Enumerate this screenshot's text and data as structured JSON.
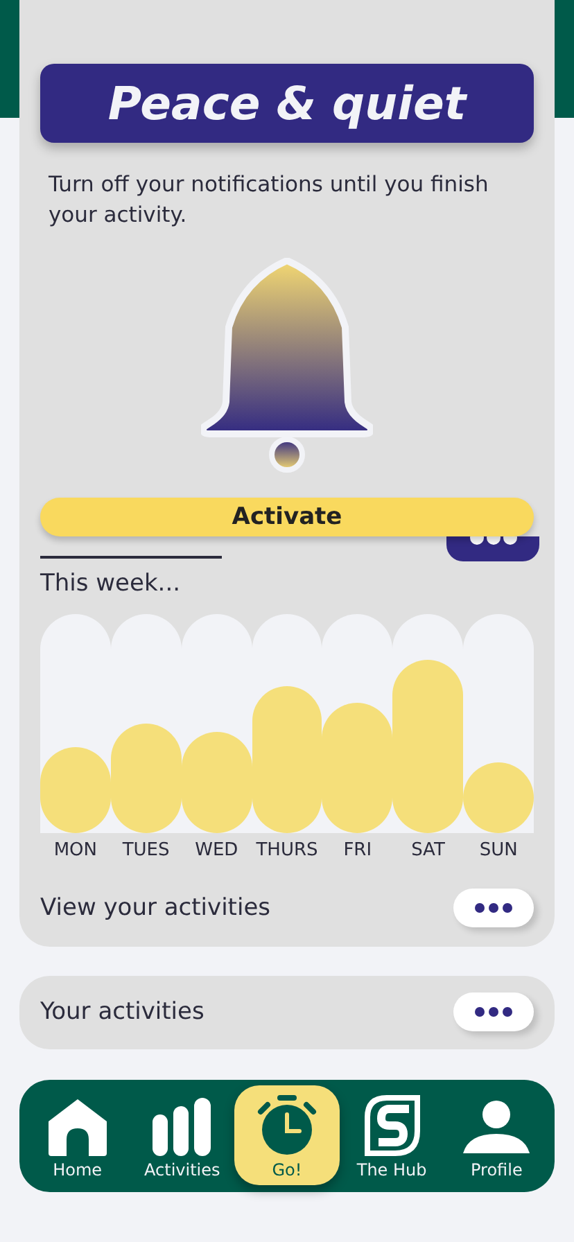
{
  "modal": {
    "title": "Peace & quiet",
    "description": "Turn off your notifications until you finish your activity.",
    "action": "Activate"
  },
  "week": {
    "title": "This week...",
    "days": [
      {
        "label": "MON",
        "level": 0.39
      },
      {
        "label": "TUES",
        "level": 0.5
      },
      {
        "label": "WED",
        "level": 0.46
      },
      {
        "label": "THURS",
        "level": 0.67
      },
      {
        "label": "FRI",
        "level": 0.59
      },
      {
        "label": "SAT",
        "level": 0.79
      },
      {
        "label": "SUN",
        "level": 0.32
      }
    ],
    "link": "View your activities"
  },
  "activities": {
    "title": "Your activities"
  },
  "nav": [
    {
      "label": "Home",
      "kind": "home",
      "selected": false
    },
    {
      "label": "Activities",
      "kind": "activities",
      "selected": false
    },
    {
      "label": "Go!",
      "kind": "go",
      "selected": true
    },
    {
      "label": "The Hub",
      "kind": "hub",
      "selected": false
    },
    {
      "label": "Profile",
      "kind": "profile",
      "selected": false
    }
  ]
}
